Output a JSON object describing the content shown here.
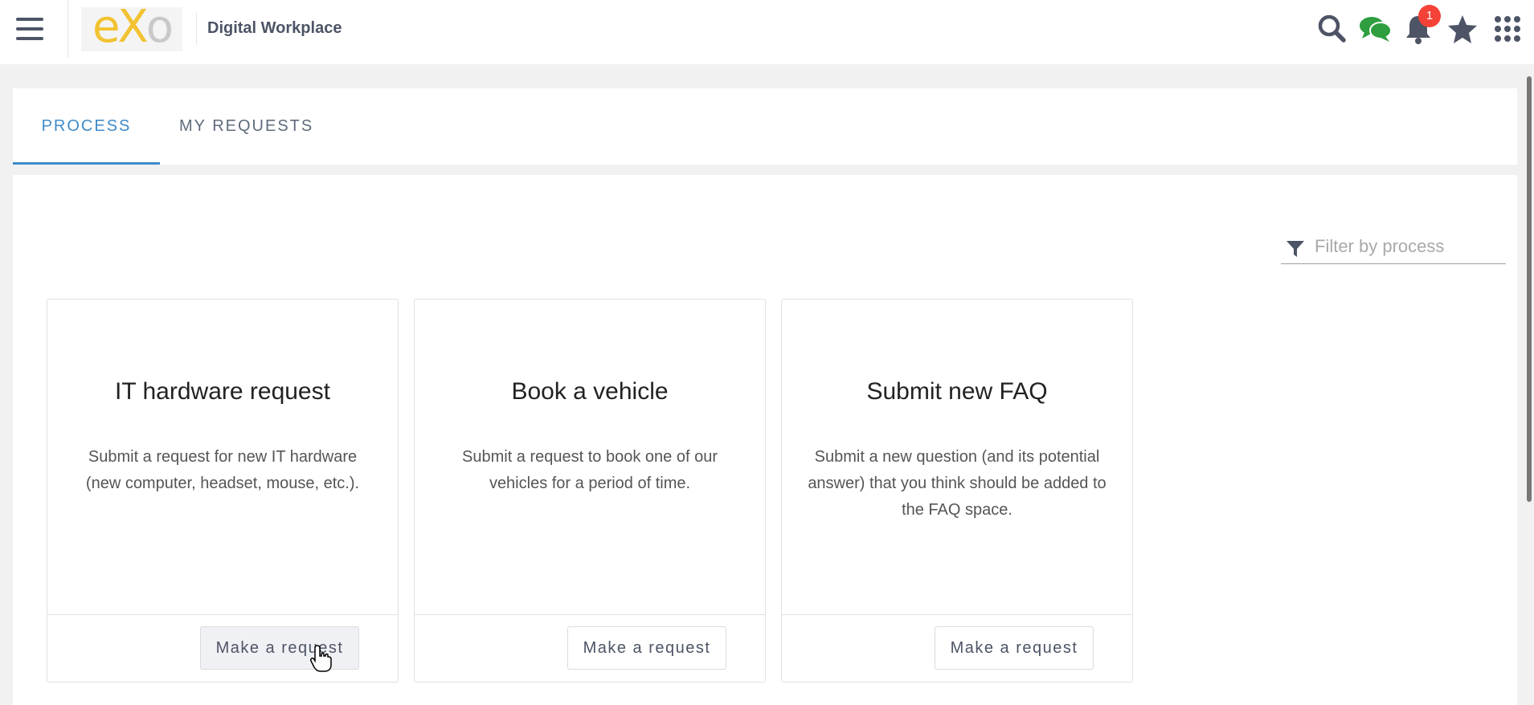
{
  "header": {
    "brand_title": "Digital Workplace",
    "logo_text": "eXo",
    "notification_count": "1",
    "icons": [
      "hamburger-icon",
      "search-icon",
      "chat-icon",
      "bell-icon",
      "star-icon",
      "apps-grid-icon"
    ],
    "colors": {
      "chat": "#2e9e3e",
      "badge": "#f44336",
      "icon": "#4d5466"
    }
  },
  "tabs": [
    {
      "label": "PROCESS",
      "active": true
    },
    {
      "label": "MY REQUESTS",
      "active": false
    }
  ],
  "filter": {
    "placeholder": "Filter by process",
    "value": ""
  },
  "cards": [
    {
      "title": "IT hardware request",
      "description": "Submit a request for new IT hardware (new computer, headset, mouse, etc.).",
      "button_label": "Make a request"
    },
    {
      "title": "Book a vehicle",
      "description": "Submit a request to book one of our vehicles for a period of time.",
      "button_label": "Make a request"
    },
    {
      "title": "Submit new FAQ",
      "description": "Submit a new question (and its potential answer) that you think should be added to the FAQ space.",
      "button_label": "Make a request"
    }
  ]
}
